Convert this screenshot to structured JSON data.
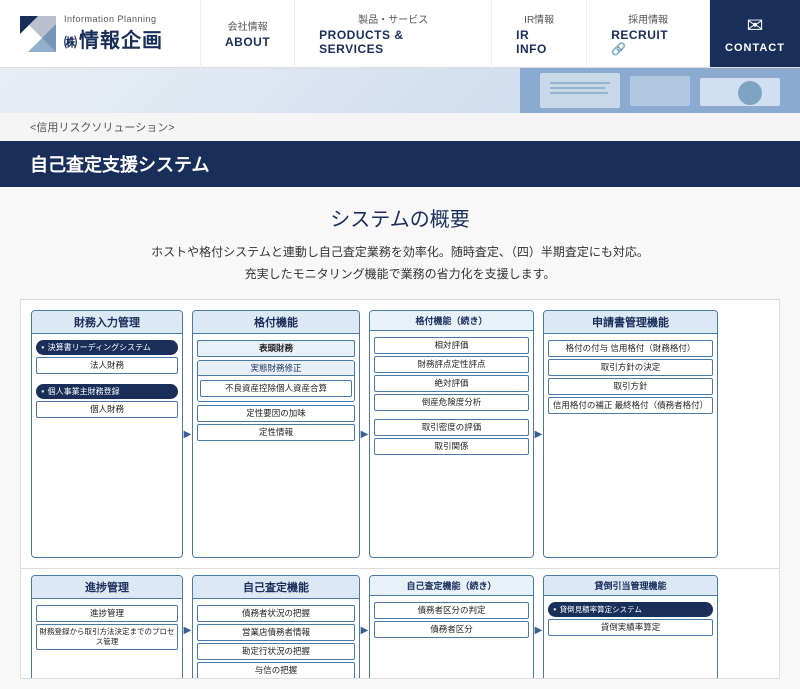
{
  "header": {
    "logo": {
      "subtitle": "Information Planning",
      "kanji": "㈱",
      "main": "情報企画"
    },
    "nav": [
      {
        "jp": "会社情報",
        "en": "ABOUT"
      },
      {
        "jp": "製品・サービス",
        "en": "PRODUCTS & SERVICES"
      },
      {
        "jp": "IR情報",
        "en": "IR INFO"
      },
      {
        "jp": "採用情報",
        "en": "RECRUIT"
      }
    ],
    "contact": "CONTACT"
  },
  "breadcrumb": "<信用リスクソリューション>",
  "page_title": "自己査定支援システム",
  "section_title": "システムの概要",
  "description_line1": "ホストや格付システムと連動し自己査定業務を効率化。随時査定、（四）半期査定にも対応。",
  "description_line2": "充実したモニタリング機能で業務の省力化を支援します。",
  "diagram": {
    "col1_title": "財務入力管理",
    "col2_title": "格付機能",
    "col3_title": "申請書管理機能",
    "col4_title": "",
    "col1_items": [
      "決算書リーディングシステム",
      "法人財務",
      "個人事業主財務登録",
      "個人財務"
    ],
    "col2_items": [
      "表頭財務",
      "実態財務修正",
      "不良資産控除個人資産合算",
      "定性要因の加味",
      "定性情報",
      "相対評価",
      "財務評点定性評点",
      "絶対評価",
      "倒産危険度分析"
    ],
    "col3_items": [
      "取引密度の評価",
      "取引関係",
      "格付の付与 信用格付（財務格付）",
      "取引方針の決定",
      "取引方針",
      "信用格付の補正 最終格付（債務者格付）"
    ],
    "bottom_col1_title": "進捗管理",
    "bottom_col2_title": "自己査定機能",
    "bottom_col3_title": "貸倒引当管理機能",
    "bottom_col1_items": [
      "進捗管理",
      "財務登録から取引方法決定までのプロセス管理"
    ],
    "bottom_col2_items": [
      "債務者状況の把握",
      "営業店債務者情報",
      "勘定行状況の把握",
      "与信の把握",
      "債務者区分の判定",
      "債務者区分"
    ],
    "bottom_col3_items": [
      "貸倒見積率算定システム",
      "貸倒実績率算定"
    ]
  }
}
